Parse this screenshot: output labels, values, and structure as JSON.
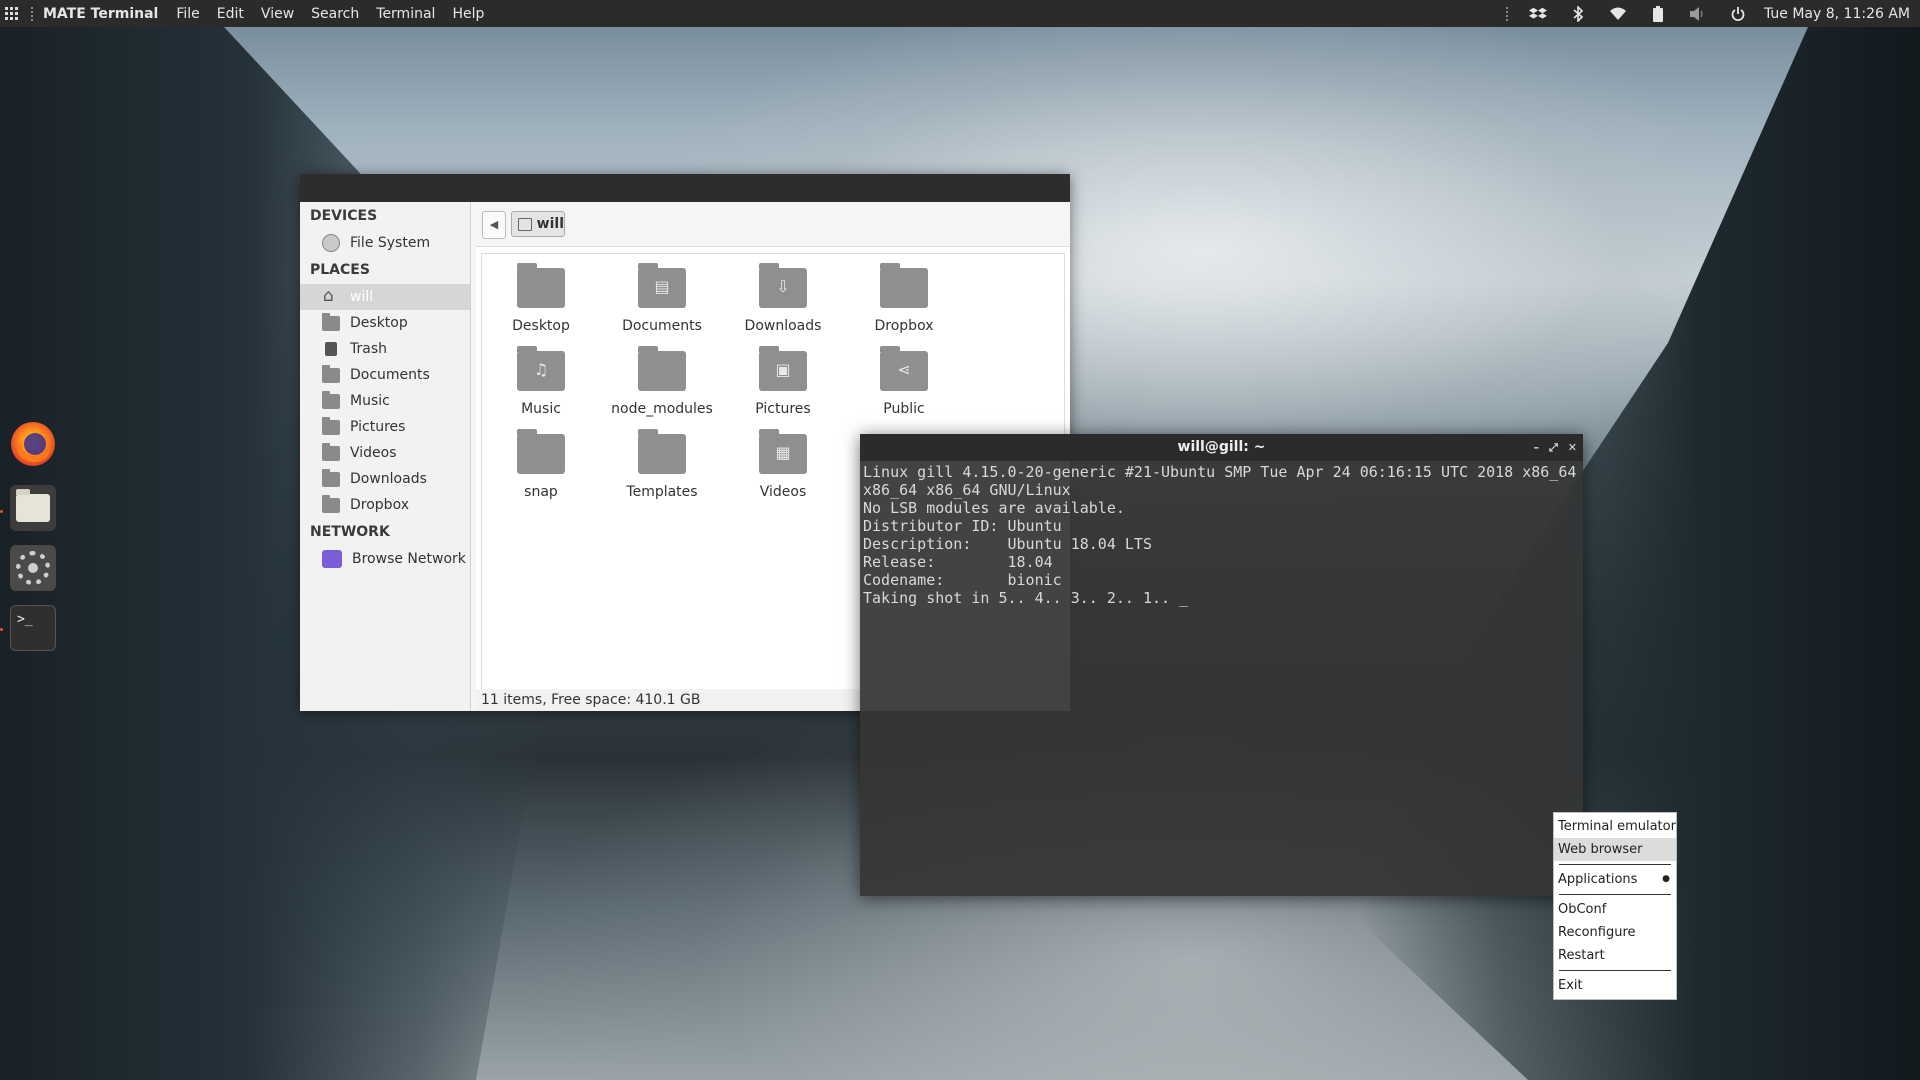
{
  "top_panel": {
    "app_name": "MATE Terminal",
    "menu": [
      "File",
      "Edit",
      "View",
      "Search",
      "Terminal",
      "Help"
    ],
    "clock": "Tue May 8, 11:26 AM",
    "tray_icons": [
      "dropbox-icon",
      "bluetooth-icon",
      "wifi-icon",
      "battery-icon",
      "volume-icon",
      "power-icon"
    ]
  },
  "dock": {
    "apps": [
      "firefox",
      "files",
      "settings",
      "terminal"
    ],
    "terminal_glyph": ">_"
  },
  "file_manager": {
    "sidebar": {
      "devices_heading": "DEVICES",
      "devices": [
        "File System"
      ],
      "places_heading": "PLACES",
      "places": [
        "will",
        "Desktop",
        "Trash",
        "Documents",
        "Music",
        "Pictures",
        "Videos",
        "Downloads",
        "Dropbox"
      ],
      "network_heading": "NETWORK",
      "network": [
        "Browse Network"
      ]
    },
    "path": "will",
    "folders": [
      "Desktop",
      "Documents",
      "Downloads",
      "Dropbox",
      "Music",
      "node_modules",
      "Pictures",
      "Public",
      "snap",
      "Templates",
      "Videos"
    ],
    "status": "11 items, Free space: 410.1 GB"
  },
  "terminal": {
    "title": "will@gill: ~",
    "lines": [
      "Linux gill 4.15.0-20-generic #21-Ubuntu SMP Tue Apr 24 06:16:15 UTC 2018 x86_64",
      "x86_64 x86_64 GNU/Linux",
      "No LSB modules are available.",
      "Distributor ID:\tUbuntu",
      "Description:\tUbuntu 18.04 LTS",
      "Release:\t18.04",
      "Codename:\tbionic",
      "Taking shot in 5.. 4.. 3.. 2.. 1.. _"
    ]
  },
  "context_menu": {
    "items": [
      "Terminal emulator",
      "Web browser",
      "Applications",
      "ObConf",
      "Reconfigure",
      "Restart",
      "Exit"
    ],
    "highlighted": "Web browser"
  }
}
